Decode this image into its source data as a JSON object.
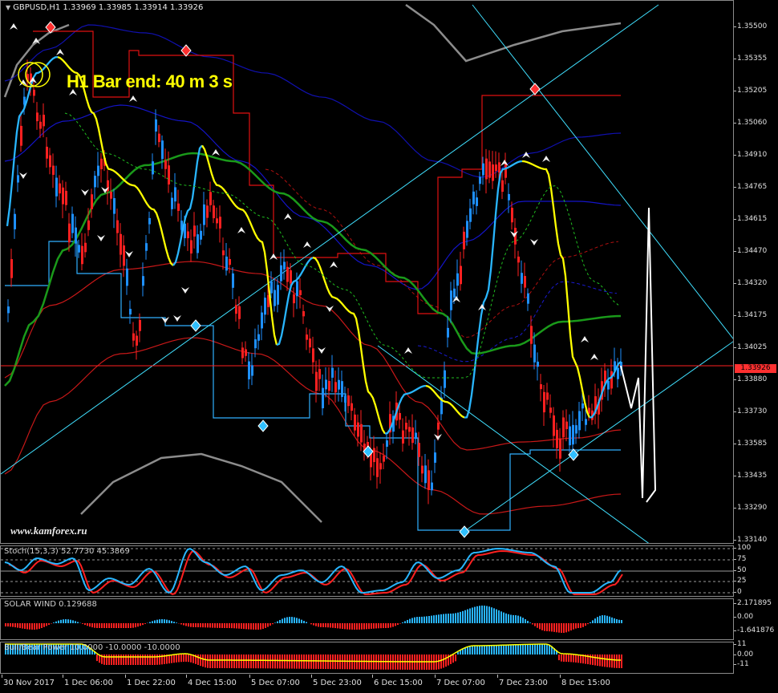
{
  "symbol": {
    "header": "GBPUSD,H1  1.33969 1.33985 1.33914 1.33926"
  },
  "overlay": {
    "bar_end": "H1 Bar end: 40 m 3 s",
    "watermark": "www.kamforex.ru"
  },
  "price_axis": [
    "1.35500",
    "1.35355",
    "1.35205",
    "1.35060",
    "1.34910",
    "1.34765",
    "1.34615",
    "1.34470",
    "1.34320",
    "1.34175",
    "1.34025",
    "1.33880",
    "1.33730",
    "1.33585",
    "1.33435",
    "1.33290",
    "1.33140"
  ],
  "current_price": "1.33926",
  "indicators": {
    "stoch": {
      "title": "Stoch(15,3,3) 52.7730 45.3869",
      "levels": [
        "100",
        "75",
        "50",
        "25",
        "0"
      ]
    },
    "solar": {
      "title": "SOLAR WIND 0.129688",
      "levels": [
        "2.171895",
        "0.00",
        "-1.641876"
      ]
    },
    "bb": {
      "title": "Bull/Bear Power 10.0000 -10.0000 -10.0000",
      "levels": [
        "11",
        "0.00",
        "-11"
      ]
    }
  },
  "time_axis": [
    "30 Nov 2017",
    "1 Dec 06:00",
    "1 Dec 22:00",
    "4 Dec 15:00",
    "5 Dec 07:00",
    "5 Dec 23:00",
    "6 Dec 15:00",
    "7 Dec 07:00",
    "7 Dec 23:00",
    "8 Dec 15:00"
  ],
  "colors": {
    "bull": "#1e90ff",
    "bear": "#ff2020",
    "signal": "#ffff00",
    "trendline": "#40e0ff",
    "ma": "#1a9a1a"
  },
  "chart_data": {
    "type": "candlestick",
    "title": "GBPUSD,H1",
    "ylim": [
      1.3314,
      1.3557
    ],
    "approx_close_path": [
      1.342,
      1.353,
      1.35,
      1.347,
      1.344,
      1.349,
      1.346,
      1.34,
      1.35,
      1.347,
      1.345,
      1.347,
      1.344,
      1.339,
      1.342,
      1.344,
      1.342,
      1.338,
      1.339,
      1.336,
      1.335,
      1.337,
      1.336,
      1.334,
      1.342,
      1.346,
      1.349,
      1.348,
      1.343,
      1.338,
      1.336,
      1.337,
      1.338,
      1.3395
    ]
  }
}
